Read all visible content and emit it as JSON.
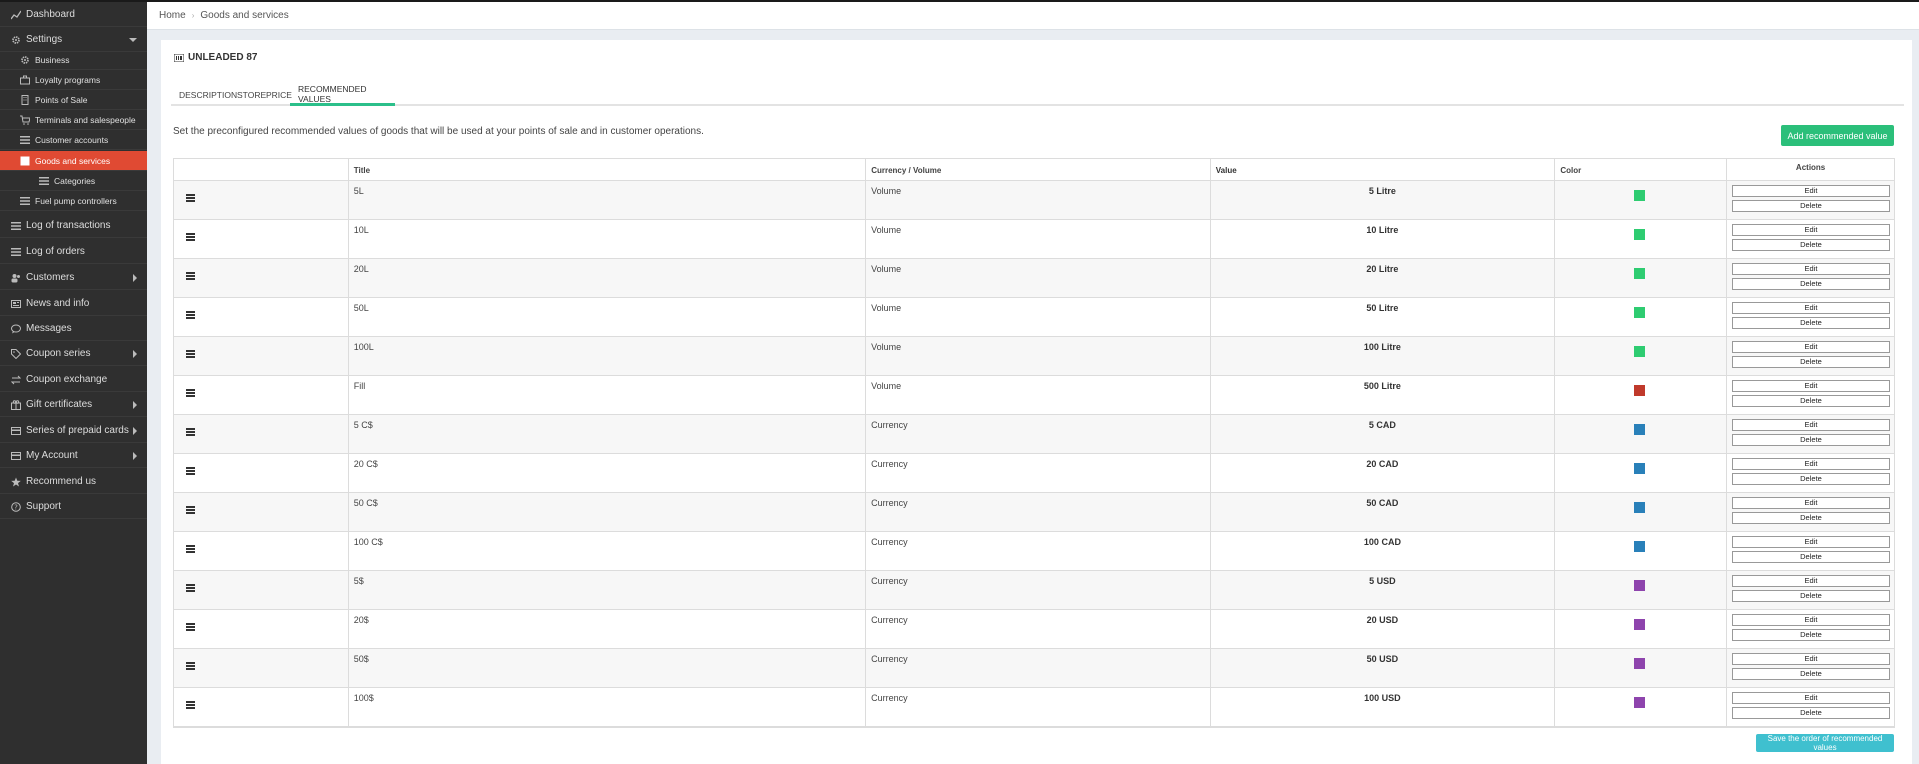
{
  "sidebar": {
    "items": [
      {
        "label": "Dashboard",
        "icon": "chart-icon",
        "sub": false,
        "arrow": ""
      },
      {
        "label": "Settings",
        "icon": "gear-icon",
        "sub": false,
        "arrow": "down"
      },
      {
        "label": "Business",
        "icon": "gear-icon",
        "sub": true,
        "arrow": ""
      },
      {
        "label": "Loyalty programs",
        "icon": "briefcase-icon",
        "sub": true,
        "arrow": ""
      },
      {
        "label": "Points of Sale",
        "icon": "building-icon",
        "sub": true,
        "arrow": ""
      },
      {
        "label": "Terminals and salespeople",
        "icon": "cart-icon",
        "sub": true,
        "arrow": ""
      },
      {
        "label": "Customer accounts",
        "icon": "list-icon",
        "sub": true,
        "arrow": ""
      },
      {
        "label": "Goods and services",
        "icon": "box-icon",
        "sub": true,
        "arrow": "",
        "active": true
      },
      {
        "label": "Categories",
        "icon": "list-icon",
        "sub": true,
        "arrow": "",
        "deep": true
      },
      {
        "label": "Fuel pump controllers",
        "icon": "list-icon",
        "sub": true,
        "arrow": ""
      },
      {
        "label": "Log of transactions",
        "icon": "list-icon",
        "sub": false,
        "arrow": ""
      },
      {
        "label": "Log of orders",
        "icon": "list-icon",
        "sub": false,
        "arrow": ""
      },
      {
        "label": "Customers",
        "icon": "users-icon",
        "sub": false,
        "arrow": "right"
      },
      {
        "label": "News and info",
        "icon": "newspaper-icon",
        "sub": false,
        "arrow": ""
      },
      {
        "label": "Messages",
        "icon": "chat-icon",
        "sub": false,
        "arrow": ""
      },
      {
        "label": "Coupon series",
        "icon": "tag-icon",
        "sub": false,
        "arrow": "right"
      },
      {
        "label": "Coupon exchange",
        "icon": "exchange-icon",
        "sub": false,
        "arrow": ""
      },
      {
        "label": "Gift certificates",
        "icon": "gift-icon",
        "sub": false,
        "arrow": "right"
      },
      {
        "label": "Series of prepaid cards",
        "icon": "card-icon",
        "sub": false,
        "arrow": "right"
      },
      {
        "label": "My Account",
        "icon": "card-icon",
        "sub": false,
        "arrow": "right"
      },
      {
        "label": "Recommend us",
        "icon": "star-icon",
        "sub": false,
        "arrow": ""
      },
      {
        "label": "Support",
        "icon": "question-icon",
        "sub": false,
        "arrow": ""
      }
    ]
  },
  "breadcrumb": {
    "home": "Home",
    "current": "Goods and services",
    "separator": "›"
  },
  "page": {
    "title": "UNLEADED 87",
    "tabs": [
      "DESCRIPTION",
      "STORE",
      "PRICE",
      "RECOMMENDED VALUES"
    ],
    "active_tab": "RECOMMENDED VALUES",
    "description": "Set the preconfigured recommended values of goods that will be used at your points of sale and in customer operations.",
    "add_button": "Add recommended value",
    "save_button": "Save the order of recommended values"
  },
  "table": {
    "headers": [
      "",
      "Title",
      "Currency / Volume",
      "Value",
      "Color",
      "Actions"
    ],
    "edit_label": "Edit",
    "delete_label": "Delete",
    "rows": [
      {
        "title": "5L",
        "type": "Volume",
        "value": "5 Litre",
        "color": "#2ecc71"
      },
      {
        "title": "10L",
        "type": "Volume",
        "value": "10 Litre",
        "color": "#2ecc71"
      },
      {
        "title": "20L",
        "type": "Volume",
        "value": "20 Litre",
        "color": "#2ecc71"
      },
      {
        "title": "50L",
        "type": "Volume",
        "value": "50 Litre",
        "color": "#2ecc71"
      },
      {
        "title": "100L",
        "type": "Volume",
        "value": "100 Litre",
        "color": "#2ecc71"
      },
      {
        "title": "Fill",
        "type": "Volume",
        "value": "500 Litre",
        "color": "#c0392b"
      },
      {
        "title": "5 C$",
        "type": "Currency",
        "value": "5 CAD",
        "color": "#2980b9"
      },
      {
        "title": "20 C$",
        "type": "Currency",
        "value": "20 CAD",
        "color": "#2980b9"
      },
      {
        "title": "50 C$",
        "type": "Currency",
        "value": "50 CAD",
        "color": "#2980b9"
      },
      {
        "title": "100 C$",
        "type": "Currency",
        "value": "100 CAD",
        "color": "#2980b9"
      },
      {
        "title": "5$",
        "type": "Currency",
        "value": "5 USD",
        "color": "#8e44ad"
      },
      {
        "title": "20$",
        "type": "Currency",
        "value": "20 USD",
        "color": "#8e44ad"
      },
      {
        "title": "50$",
        "type": "Currency",
        "value": "50 USD",
        "color": "#8e44ad"
      },
      {
        "title": "100$",
        "type": "Currency",
        "value": "100 USD",
        "color": "#8e44ad"
      }
    ]
  }
}
